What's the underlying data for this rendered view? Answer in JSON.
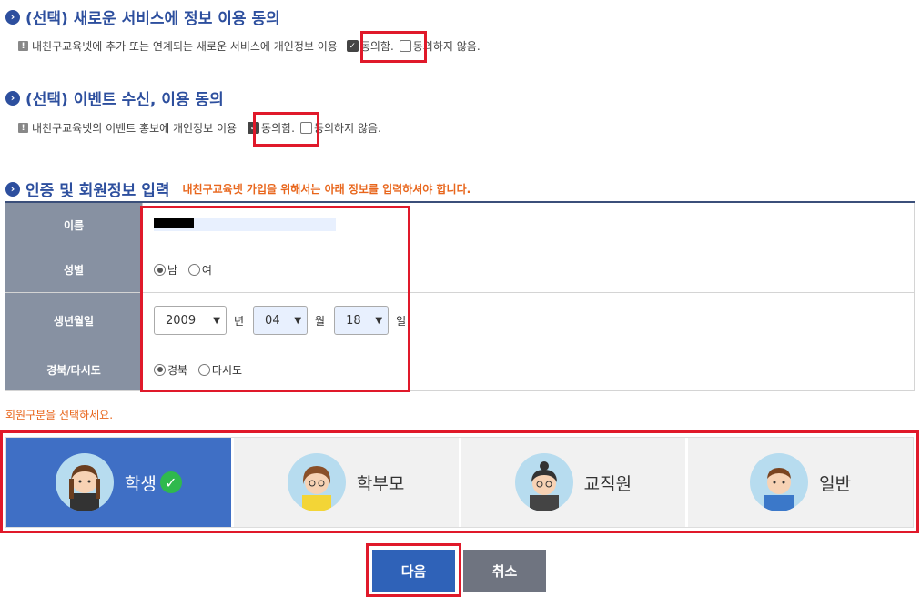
{
  "section1": {
    "title": "(선택) 새로운 서비스에 정보 이용 동의",
    "text": "내친구교육넷에 추가 또는 연계되는 새로운 서비스에 개인정보 이용",
    "agree": "동의함.",
    "disagree": "동의하지 않음."
  },
  "section2": {
    "title": "(선택) 이벤트 수신, 이용 동의",
    "text": "내친구교육넷의 이벤트 홍보에 개인정보 이용",
    "agree": "동의함.",
    "disagree": "동의하지 않음."
  },
  "section3": {
    "title": "인증 및 회원정보 입력",
    "note": "내친구교육넷 가입을 위해서는 아래 정보를 입력하셔야 합니다."
  },
  "form": {
    "name_label": "이름",
    "gender_label": "성별",
    "gender_male": "남",
    "gender_female": "여",
    "birth_label": "생년월일",
    "year": "2009",
    "year_unit": "년",
    "month": "04",
    "month_unit": "월",
    "day": "18",
    "day_unit": "일",
    "region_label": "경북/타시도",
    "region_gyeongbuk": "경북",
    "region_other": "타시도"
  },
  "member_type": {
    "prompt": "회원구분을 선택하세요.",
    "student": "학생",
    "parent": "학부모",
    "staff": "교직원",
    "general": "일반"
  },
  "buttons": {
    "next": "다음",
    "cancel": "취소"
  },
  "colors": {
    "accent": "#2d4f9e",
    "active_card": "#3f6fc5",
    "next_button": "#2f62b8",
    "cancel_button": "#6f7480",
    "highlight": "#e0192a"
  }
}
